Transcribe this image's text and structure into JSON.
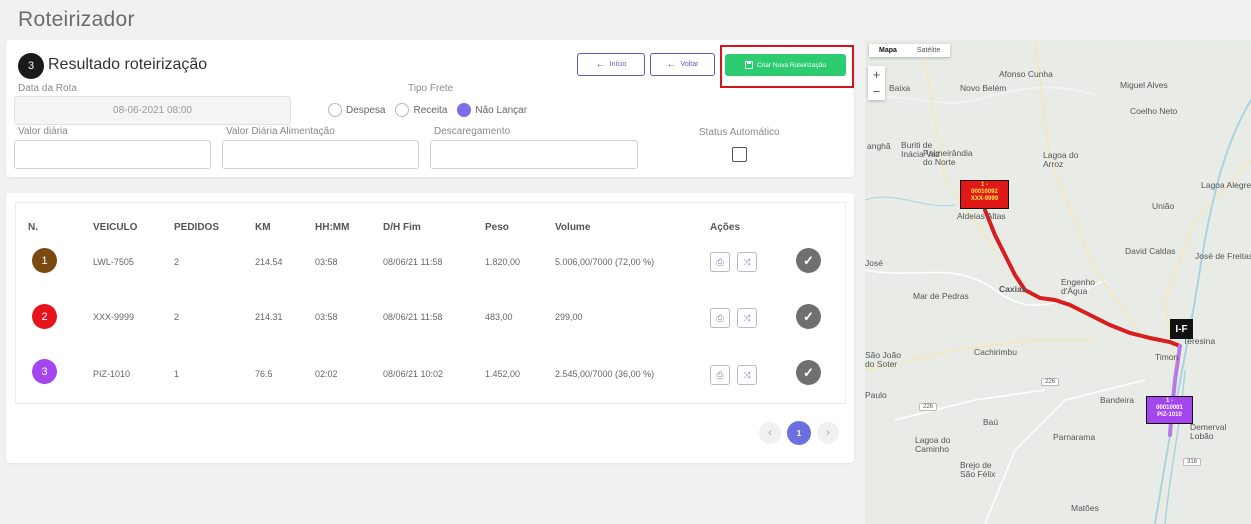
{
  "page": {
    "title": "Roteirizador"
  },
  "result": {
    "step": "3",
    "title": "Resultado roteirização",
    "buttons": {
      "inicio": "Início",
      "voltar": "Voltar",
      "create": "Criar Nova Roteirização"
    },
    "date_label": "Data da Rota",
    "date_value": "08-06-2021 08:00",
    "tipo_frete_label": "Tipo Frete",
    "tipo_frete_options": [
      {
        "label": "Despesa",
        "checked": false
      },
      {
        "label": "Receita",
        "checked": false
      },
      {
        "label": "Não Lançar",
        "checked": true
      }
    ],
    "valor_diaria_label": "Valor diária",
    "valor_alimentacao_label": "Valor Diária Alimentação",
    "descarregamento_label": "Descaregamento",
    "status_label": "Status Automático"
  },
  "table": {
    "headers": [
      "N.",
      "VEICULO",
      "PEDIDOS",
      "KM",
      "HH:MM",
      "D/H Fim",
      "Peso",
      "Volume",
      "Ações"
    ],
    "rows": [
      {
        "n": "1",
        "color": "#7a4a10",
        "veiculo": "LWL-7505",
        "pedidos": "2",
        "km": "214.54",
        "hhmm": "03:58",
        "fim": "08/06/21 11:58",
        "peso": "1.820,00",
        "volume": "5.006,00/7000 (72,00 %)"
      },
      {
        "n": "2",
        "color": "#e8141c",
        "veiculo": "XXX-9999",
        "pedidos": "2",
        "km": "214.31",
        "hhmm": "03:58",
        "fim": "08/06/21 11:58",
        "peso": "483,00",
        "volume": "299,00"
      },
      {
        "n": "3",
        "color": "#a545ee",
        "veiculo": "PIZ-1010",
        "pedidos": "1",
        "km": "76.5",
        "hhmm": "02:02",
        "fim": "08/06/21 10:02",
        "peso": "1.452,00",
        "volume": "2.545,00/7000 (36,00 %)"
      }
    ]
  },
  "pagination": {
    "prev": "‹",
    "current": "1",
    "next": "›"
  },
  "map": {
    "type_map": "Mapa",
    "type_satellite": "Satélite",
    "zoom_in": "+",
    "zoom_out": "−",
    "cities": [
      "Baixa",
      "Novo Belém",
      "Afonso Cunha",
      "Miguel Alves",
      "Coelho Neto",
      "anghã",
      "Buriti de Inácia Vaz",
      "Palmeirândia do Norte",
      "Lagoa do Arroz",
      "Lagoa Alegre",
      "União",
      "Aldeias Altas",
      "José",
      "David Caldas",
      "José de Freitas",
      "Mar de Pedras",
      "Caxias",
      "Engenho d'Água",
      "Cachirimbu",
      "São João do Soter",
      "Timon",
      "Teresina",
      "Paulo",
      "Baú",
      "Bandeira",
      "Demerval Lobão",
      "Lagoa do Caminho",
      "Parnarama",
      "Brejo de São Félix",
      "Matões"
    ],
    "roads": [
      "316",
      "226",
      "226",
      "316"
    ],
    "marker_red": [
      "1 -",
      "00010092",
      "XXX-9999"
    ],
    "marker_purple": [
      "1 -",
      "00010001",
      "PIZ-1010"
    ],
    "marker_if": "I-F"
  }
}
